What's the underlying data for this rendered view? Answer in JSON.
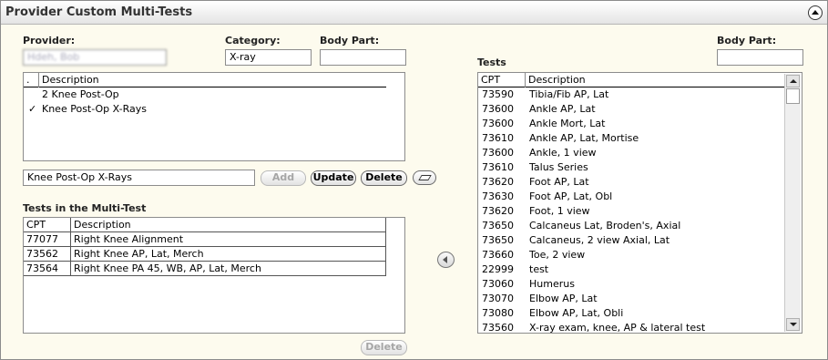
{
  "title": "Provider Custom Multi-Tests",
  "provider": {
    "label": "Provider:",
    "value": "Hdeh, Bob"
  },
  "category": {
    "label": "Category:",
    "value": "X-ray"
  },
  "body_part_left": {
    "label": "Body Part:",
    "value": ""
  },
  "multitests": {
    "header": [
      ".",
      "Description"
    ],
    "items": [
      {
        "check": "",
        "label": "2 Knee Post-Op"
      },
      {
        "check": "✓",
        "label": "Knee Post-Op X-Rays"
      }
    ]
  },
  "name_input": {
    "value": "Knee Post-Op X-Rays"
  },
  "buttons": {
    "add": "Add",
    "update": "Update",
    "delete": "Delete",
    "delete_bottom": "Delete"
  },
  "in_multitest": {
    "label": "Tests in the Multi-Test",
    "header": [
      "CPT",
      "Description"
    ],
    "rows": [
      {
        "cpt": "77077",
        "desc": "Right Knee Alignment"
      },
      {
        "cpt": "73562",
        "desc": "Right Knee AP, Lat, Merch"
      },
      {
        "cpt": "73564",
        "desc": "Right Knee PA 45, WB, AP, Lat, Merch"
      }
    ]
  },
  "tests": {
    "label": "Tests",
    "body_part_label": "Body Part:",
    "body_part_value": "",
    "header": [
      "CPT",
      "Description"
    ],
    "rows": [
      {
        "cpt": "73590",
        "desc": "Tibia/Fib AP, Lat"
      },
      {
        "cpt": "73600",
        "desc": "Ankle AP, Lat"
      },
      {
        "cpt": "73600",
        "desc": "Ankle Mort, Lat"
      },
      {
        "cpt": "73610",
        "desc": "Ankle AP, Lat, Mortise"
      },
      {
        "cpt": "73600",
        "desc": "Ankle, 1 view"
      },
      {
        "cpt": "73610",
        "desc": "Talus Series"
      },
      {
        "cpt": "73620",
        "desc": "Foot AP, Lat"
      },
      {
        "cpt": "73630",
        "desc": "Foot AP, Lat, Obl"
      },
      {
        "cpt": "73620",
        "desc": "Foot, 1 view"
      },
      {
        "cpt": "73650",
        "desc": "Calcaneus Lat, Broden's, Axial"
      },
      {
        "cpt": "73650",
        "desc": "Calcaneus, 2 view Axial, Lat"
      },
      {
        "cpt": "73660",
        "desc": "Toe, 2 view"
      },
      {
        "cpt": "22999",
        "desc": "test"
      },
      {
        "cpt": "73060",
        "desc": "Humerus"
      },
      {
        "cpt": "73070",
        "desc": "Elbow AP, Lat"
      },
      {
        "cpt": "73080",
        "desc": "Elbow AP, Lat, Obli"
      },
      {
        "cpt": "73560",
        "desc": "X-ray exam, knee, AP & lateral test"
      }
    ]
  },
  "icons": {
    "collapse": "collapse-up-icon",
    "eraser": "eraser-icon",
    "move_left": "arrow-left-icon",
    "check": "checkmark-icon"
  }
}
